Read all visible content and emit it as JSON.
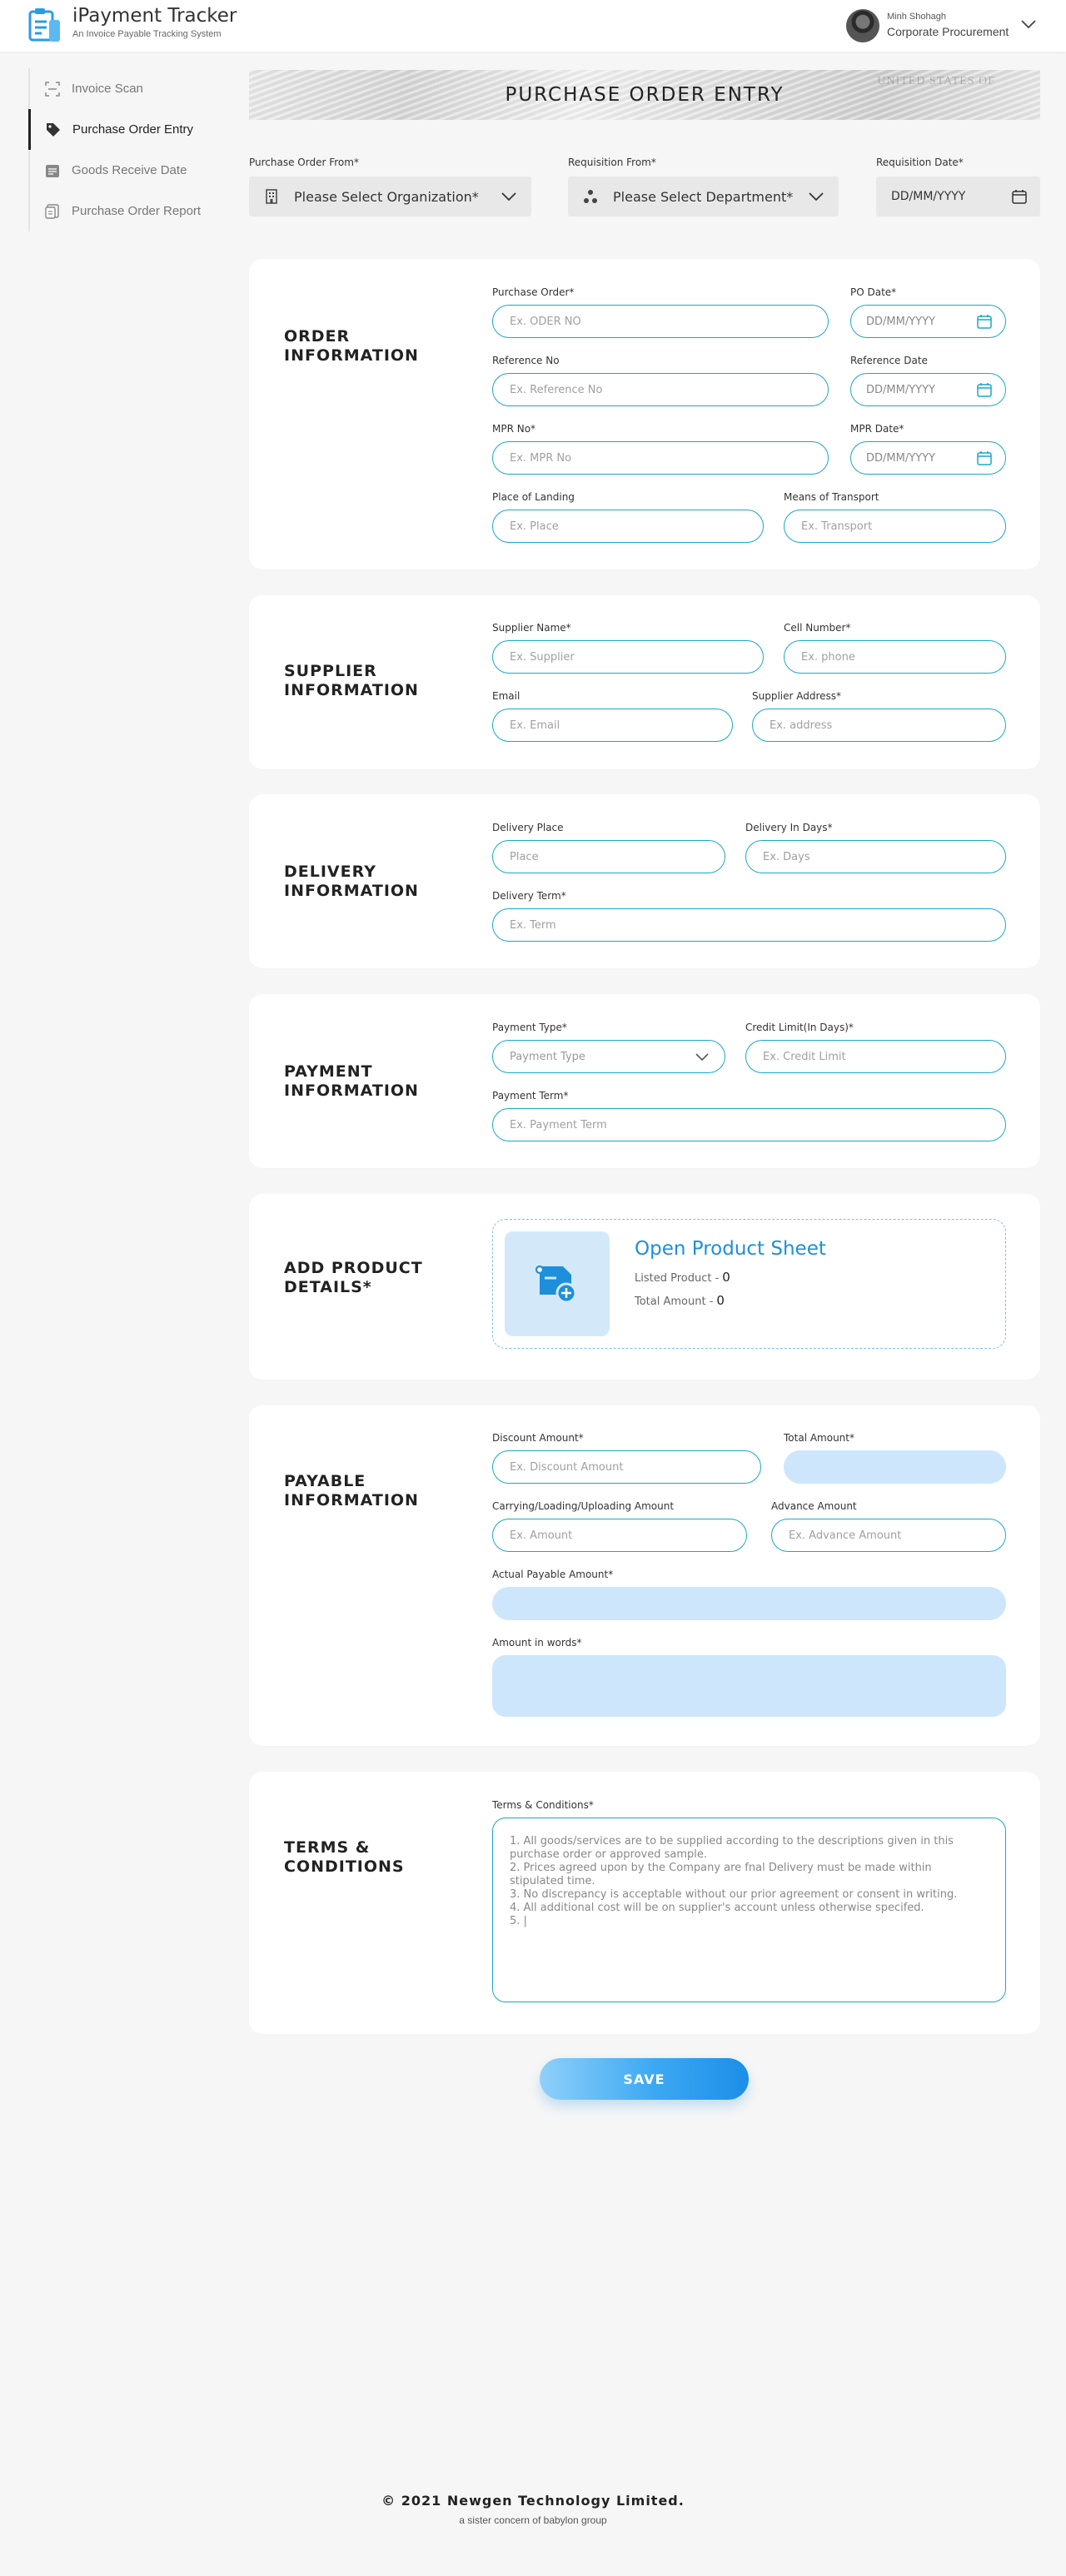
{
  "app": {
    "title": "iPayment Tracker",
    "subtitle": "An Invoice Payable Tracking System"
  },
  "user": {
    "name": "Minh Shohagh",
    "role": "Corporate Procurement"
  },
  "sidebar": {
    "items": [
      {
        "label": "Invoice Scan",
        "icon": "scan-icon",
        "active": false
      },
      {
        "label": "Purchase Order Entry",
        "icon": "tag-icon",
        "active": true
      },
      {
        "label": "Goods Receive Date",
        "icon": "calendar-list-icon",
        "active": false
      },
      {
        "label": "Purchase Order Report",
        "icon": "report-icon",
        "active": false
      }
    ]
  },
  "banner": {
    "title": "PURCHASE ORDER ENTRY",
    "watermark": "UNITED STATES OF"
  },
  "top": {
    "org_label": "Purchase Order From*",
    "org_value": "Please Select Organization*",
    "dept_label": "Requisition From*",
    "dept_value": "Please Select Department*",
    "req_date_label": "Requisition Date*",
    "req_date_value": "DD/MM/YYYY"
  },
  "order": {
    "title_1": "ORDER",
    "title_2": "INFORMATION",
    "po_label": "Purchase Order*",
    "po_placeholder": "Ex. ODER NO",
    "po_date_label": "PO Date*",
    "po_date_value": "DD/MM/YYYY",
    "ref_label": "Reference No",
    "ref_placeholder": "Ex. Reference No",
    "ref_date_label": "Reference Date",
    "ref_date_value": "DD/MM/YYYY",
    "mpr_label": "MPR No*",
    "mpr_placeholder": "Ex. MPR No",
    "mpr_date_label": "MPR Date*",
    "mpr_date_value": "DD/MM/YYYY",
    "landing_label": "Place of Landing",
    "landing_placeholder": "Ex. Place",
    "transport_label": "Means of Transport",
    "transport_placeholder": "Ex. Transport"
  },
  "supplier": {
    "title_1": "SUPPLIER",
    "title_2": "INFORMATION",
    "name_label": "Supplier Name*",
    "name_placeholder": "Ex. Supplier",
    "cell_label": "Cell Number*",
    "cell_placeholder": "Ex. phone",
    "email_label": "Email",
    "email_placeholder": "Ex. Email",
    "address_label": "Supplier Address*",
    "address_placeholder": "Ex. address"
  },
  "delivery": {
    "title_1": "DELIVERY",
    "title_2": "INFORMATION",
    "place_label": "Delivery Place",
    "place_placeholder": "Place",
    "days_label": "Delivery In Days*",
    "days_placeholder": "Ex. Days",
    "term_label": "Delivery Term*",
    "term_placeholder": "Ex. Term"
  },
  "payment": {
    "title_1": "PAYMENT",
    "title_2": "INFORMATION",
    "type_label": "Payment Type*",
    "type_value": "Payment Type",
    "credit_label": "Credit Limit(In Days)*",
    "credit_placeholder": "Ex. Credit Limit",
    "term_label": "Payment Term*",
    "term_placeholder": "Ex. Payment Term"
  },
  "product": {
    "title_1": "ADD PRODUCT",
    "title_2": "DETAILS*",
    "sheet_title": "Open Product Sheet",
    "listed_label": "Listed Product -",
    "listed_value": "0",
    "total_label": "Total Amount -",
    "total_value": "0"
  },
  "payable": {
    "title_1": "PAYABLE",
    "title_2": "INFORMATION",
    "discount_label": "Discount Amount*",
    "discount_placeholder": "Ex. Discount Amount",
    "total_label": "Total Amount*",
    "carrying_label": "Carrying/Loading/Uploading Amount",
    "carrying_placeholder": "Ex. Amount",
    "advance_label": "Advance Amount",
    "advance_placeholder": "Ex. Advance Amount",
    "actual_label": "Actual Payable Amount*",
    "words_label": "Amount in words*"
  },
  "terms": {
    "title_1": "TERMS &",
    "title_2": "CONDITIONS",
    "label": "Terms & Conditions*",
    "text": "1. All goods/services are to be supplied according to the descriptions given in this purchase order or approved sample.\n2. Prices agreed upon by the Company are fnal Delivery must be made within stipulated time.\n3. No discrepancy is acceptable without our prior agreement or consent in writing.\n4. All additional cost will be on supplier's account unless otherwise specifed.\n5. |"
  },
  "actions": {
    "save_label": "SAVE"
  },
  "footer": {
    "main": "© 2021 Newgen Technology Limited.",
    "sub": "a sister concern of babylon group"
  },
  "colors": {
    "accent": "#1aa7c6",
    "brand_blue": "#1e8fdb",
    "filled_field": "#cde6fb"
  }
}
